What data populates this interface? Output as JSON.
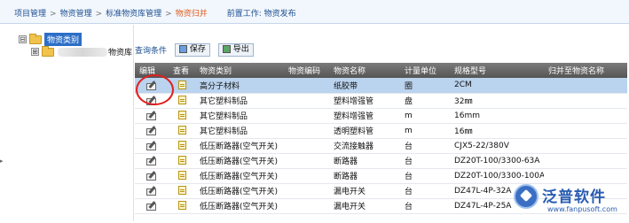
{
  "breadcrumb": {
    "items": [
      "项目管理",
      "物资管理",
      "标准物资库管理",
      "物资归并"
    ],
    "separator": ">",
    "predecessor_label": "前置工作: 物资发布"
  },
  "tree": {
    "root_label": "物资类别",
    "child_label": "物资库",
    "expand_symbol": "⊟",
    "collapse_symbol": "⊞"
  },
  "toolbar": {
    "query_label": "查询条件",
    "save_label": "保存",
    "export_label": "导出"
  },
  "table": {
    "columns": [
      "编辑",
      "查看",
      "物资类别",
      "物资编码",
      "物资名称",
      "计量单位",
      "规格型号",
      "归并至物资名称"
    ],
    "rows": [
      {
        "category": "高分子材料",
        "code": "",
        "name": "纸胶带",
        "unit": "圈",
        "spec": "2CM",
        "merged": "",
        "selected": true
      },
      {
        "category": "其它塑料制品",
        "code": "",
        "name": "塑料增强管",
        "unit": "盘",
        "spec": "32㎜",
        "merged": "",
        "selected": false
      },
      {
        "category": "其它塑料制品",
        "code": "",
        "name": "塑料增强管",
        "unit": "m",
        "spec": "16mm",
        "merged": "",
        "selected": false
      },
      {
        "category": "其它塑料制品",
        "code": "",
        "name": "透明塑料管",
        "unit": "m",
        "spec": "16㎜",
        "merged": "",
        "selected": false
      },
      {
        "category": "低压断路器(空气开关)",
        "code": "",
        "name": "交流接触器",
        "unit": "台",
        "spec": "CJX5-22/380V",
        "merged": "",
        "selected": false
      },
      {
        "category": "低压断路器(空气开关)",
        "code": "",
        "name": "断路器",
        "unit": "台",
        "spec": "DZ20T-100/3300-63A",
        "merged": "",
        "selected": false
      },
      {
        "category": "低压断路器(空气开关)",
        "code": "",
        "name": "断路器",
        "unit": "台",
        "spec": "DZ20T-100/3300-100A",
        "merged": "",
        "selected": false
      },
      {
        "category": "低压断路器(空气开关)",
        "code": "",
        "name": "漏电开关",
        "unit": "台",
        "spec": "DZ47L-4P-32A",
        "merged": "",
        "selected": false
      },
      {
        "category": "低压断路器(空气开关)",
        "code": "",
        "name": "漏电开关",
        "unit": "台",
        "spec": "DZ47L-4P-25A",
        "merged": "",
        "selected": false
      }
    ]
  },
  "watermark": {
    "brand": "泛普软件",
    "url": "www.fanpusoft.com"
  },
  "colors": {
    "header_bg": "#666666",
    "selected_row": "#bad3ee",
    "highlight_circle": "#e21d1d",
    "breadcrumb_current": "#e05c1d",
    "link": "#1d4f91"
  },
  "icons": {
    "edit": "pencil-edit-icon",
    "view": "document-view-icon",
    "save": "save-icon",
    "export": "export-icon",
    "folder": "folder-icon"
  }
}
